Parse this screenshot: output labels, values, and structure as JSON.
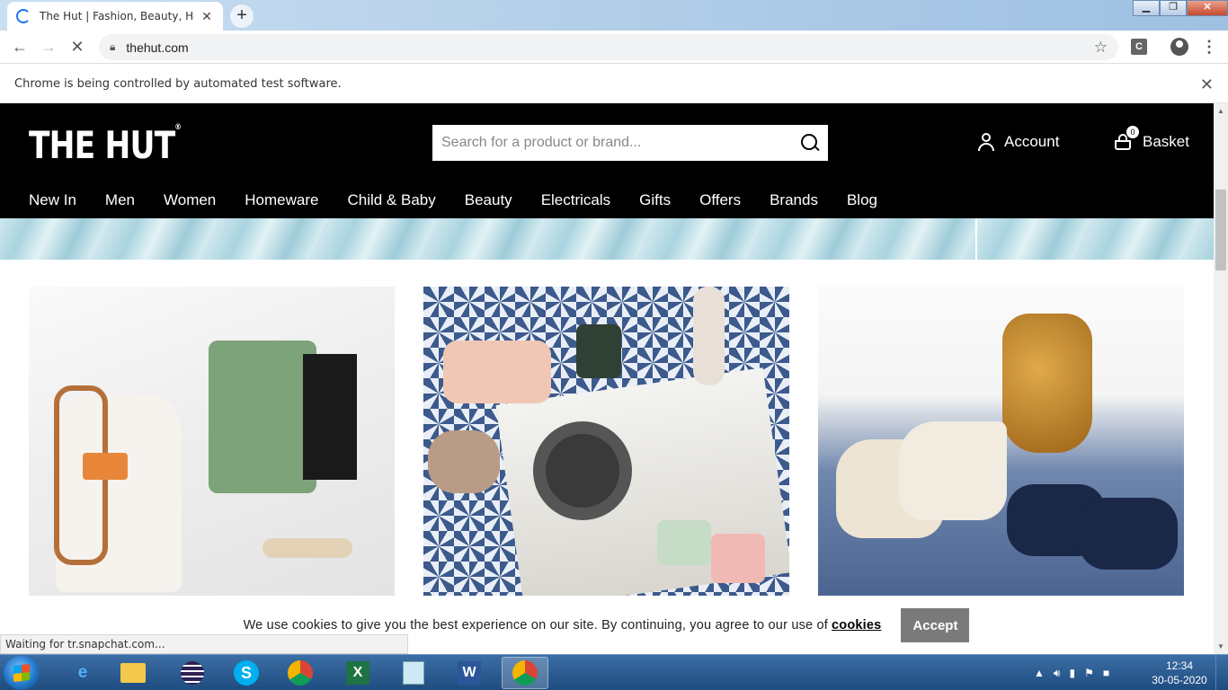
{
  "browser": {
    "tab_title": "The Hut | Fashion, Beauty, Home",
    "url": "thehut.com",
    "infobar_text": "Chrome is being controlled by automated test software.",
    "status_text": "Waiting for tr.snapchat.com...",
    "extension_label": "C"
  },
  "site": {
    "logo": "THE HUT",
    "logo_mark": "®",
    "search_placeholder": "Search for a product or brand...",
    "account_label": "Account",
    "basket_label": "Basket",
    "basket_count": "0",
    "nav": [
      "New In",
      "Men",
      "Women",
      "Homeware",
      "Child & Baby",
      "Beauty",
      "Electricals",
      "Gifts",
      "Offers",
      "Brands",
      "Blog"
    ]
  },
  "cookie": {
    "text": "We use cookies to give you the best experience on our site. By continuing, you agree to our use of",
    "link": "cookies",
    "accept_label": "Accept"
  },
  "taskbar": {
    "time": "12:34",
    "date": "30-05-2020"
  },
  "colors": {
    "header_bg": "#000000",
    "accept_button": "#7a7a7a",
    "taskbar": "#1f4c80"
  }
}
